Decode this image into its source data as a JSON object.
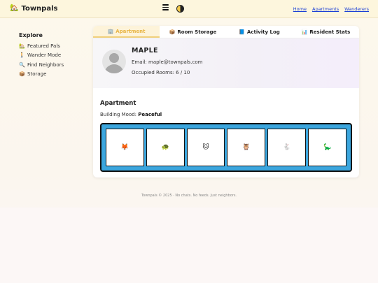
{
  "brand": {
    "name": "Townpals",
    "logo_icon": "🏡"
  },
  "header": {
    "menu_icon": "menu-icon",
    "theme_icon": "theme-toggle-icon",
    "nav": [
      {
        "label": "Home"
      },
      {
        "label": "Apartments"
      },
      {
        "label": "Wanderers"
      }
    ]
  },
  "sidebar": {
    "title": "Explore",
    "items": [
      {
        "icon": "🏡",
        "label": "Featured Pals"
      },
      {
        "icon": "🚶",
        "label": "Wander Mode"
      },
      {
        "icon": "🔍",
        "label": "Find Neighbors"
      },
      {
        "icon": "📦",
        "label": "Storage"
      }
    ]
  },
  "tabs": [
    {
      "icon": "🏢",
      "label": "Apartment",
      "active": true
    },
    {
      "icon": "📦",
      "label": "Room Storage",
      "active": false
    },
    {
      "icon": "📘",
      "label": "Activity Log",
      "active": false
    },
    {
      "icon": "📊",
      "label": "Resident Stats",
      "active": false
    }
  ],
  "profile": {
    "name": "MAPLE",
    "email": "Email: maple@townpals.com",
    "rooms_label": "Occupied Rooms: 6 / 10"
  },
  "apartment": {
    "title": "Apartment",
    "mood_label": "Building Mood:",
    "mood_value": "Peaceful",
    "rooms": [
      {
        "pal": "🦊"
      },
      {
        "pal": "🐢"
      },
      {
        "pal": "🐱"
      },
      {
        "pal": "🦉"
      },
      {
        "pal": "🐇"
      },
      {
        "pal": "🦕"
      }
    ]
  },
  "footer": {
    "text": "Townpals © 2025 · No chats. No feeds. Just neighbors."
  },
  "colors": {
    "accent": "#e8b545",
    "building": "#3ba6de",
    "link": "#1a3ed6"
  }
}
